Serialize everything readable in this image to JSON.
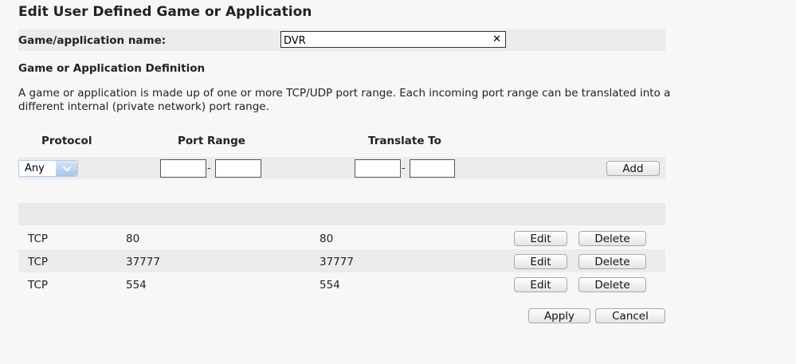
{
  "page": {
    "title": "Edit User Defined Game or Application",
    "name_label": "Game/application name:",
    "name_value": "DVR",
    "definition_heading": "Game or Application Definition",
    "description": "A game or application is made up of one or more TCP/UDP port range. Each incoming port range can be translated into a different internal (private network) port range."
  },
  "columns": {
    "protocol": "Protocol",
    "port_range": "Port Range",
    "translate_to": "Translate To"
  },
  "new_entry": {
    "protocol_selected": "Any",
    "dash1": "-",
    "dash2": "-",
    "add_label": "Add"
  },
  "rules": [
    {
      "protocol": "TCP",
      "port": "80",
      "translate": "80",
      "edit": "Edit",
      "delete": "Delete"
    },
    {
      "protocol": "TCP",
      "port": "37777",
      "translate": "37777",
      "edit": "Edit",
      "delete": "Delete"
    },
    {
      "protocol": "TCP",
      "port": "554",
      "translate": "554",
      "edit": "Edit",
      "delete": "Delete"
    }
  ],
  "footer": {
    "apply_label": "Apply",
    "cancel_label": "Cancel"
  },
  "icons": {
    "clear": "x-icon",
    "dropdown": "chevron-down-icon"
  }
}
